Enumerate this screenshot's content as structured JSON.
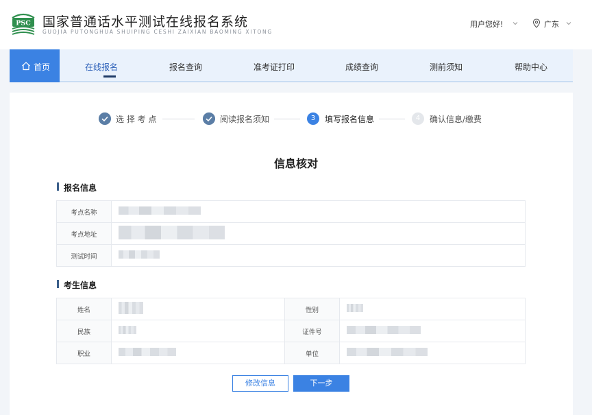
{
  "header": {
    "logo_text": "PSC",
    "title": "国家普通话水平测试在线报名系统",
    "subtitle": "GUOJIA PUTONGHUA SHUIPING CESHI ZAIXIAN BAOMING XITONG",
    "user_greeting": "用户您好!",
    "region": "广东"
  },
  "nav": {
    "home": "首页",
    "items": [
      "在线报名",
      "报名查询",
      "准考证打印",
      "成绩查询",
      "测前须知",
      "帮助中心"
    ]
  },
  "steps": [
    {
      "label": "选 择 考 点",
      "status": "done"
    },
    {
      "label": "阅读报名须知",
      "status": "done"
    },
    {
      "number": "3",
      "label": "填写报名信息",
      "status": "current"
    },
    {
      "number": "4",
      "label": "确认信息/缴费",
      "status": "pending"
    }
  ],
  "page_title": "信息核对",
  "registration": {
    "title": "报名信息",
    "rows": [
      {
        "label": "考点名称"
      },
      {
        "label": "考点地址"
      },
      {
        "label": "测试时间"
      }
    ]
  },
  "candidate": {
    "title": "考生信息",
    "rows": [
      {
        "left_label": "姓名",
        "right_label": "性别"
      },
      {
        "left_label": "民族",
        "right_label": "证件号"
      },
      {
        "left_label": "职业",
        "right_label": "单位"
      }
    ]
  },
  "buttons": {
    "modify": "修改信息",
    "next": "下一步"
  },
  "colors": {
    "primary": "#3b82e3",
    "step_done": "#5b7ea6",
    "nav_bg": "#eaf2fc",
    "page_bg": "#f2f5f9"
  }
}
